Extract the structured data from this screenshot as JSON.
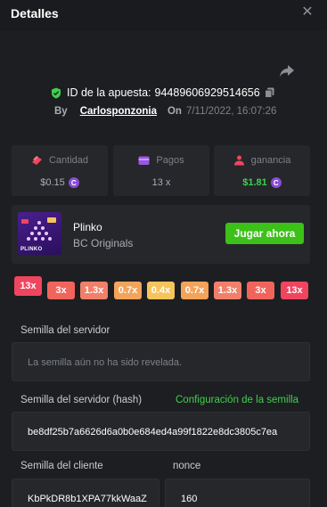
{
  "header": {
    "title": "Detalles",
    "close_icon": "close-icon"
  },
  "bet": {
    "id_label": "ID de la apuesta:",
    "id_value": "94489606929514656",
    "by_label": "By",
    "username": "Carlosponzonia",
    "on_label": "On",
    "date": "7/11/2022, 16:07:26"
  },
  "stats": {
    "amount": {
      "label": "Cantidad",
      "value": "$0.15",
      "icon": "coins-icon"
    },
    "payout": {
      "label": "Pagos",
      "value": "13 x",
      "icon": "wallet-icon"
    },
    "profit": {
      "label": "ganancia",
      "value": "$1.81",
      "icon": "profit-icon"
    },
    "coin_symbol": "C"
  },
  "game": {
    "name": "Plinko",
    "provider": "BC Originals",
    "thumbnail_label": "PLINKO",
    "play_label": "Jugar ahora"
  },
  "multipliers": [
    {
      "label": "13x",
      "color": "#f0455f",
      "selected": true
    },
    {
      "label": "3x",
      "color": "#f0645c"
    },
    {
      "label": "1.3x",
      "color": "#f0806a"
    },
    {
      "label": "0.7x",
      "color": "#f3a35a"
    },
    {
      "label": "0.4x",
      "color": "#f5c45a"
    },
    {
      "label": "0.7x",
      "color": "#f3a35a"
    },
    {
      "label": "1.3x",
      "color": "#f0806a"
    },
    {
      "label": "3x",
      "color": "#f0645c"
    },
    {
      "label": "13x",
      "color": "#f0455f"
    }
  ],
  "seeds": {
    "server_seed_label": "Semilla del servidor",
    "server_seed_value": "La semilla aún no ha sido revelada.",
    "server_hash_label": "Semilla del servidor (hash)",
    "seed_config_link": "Configuración de la semilla",
    "server_hash_value": "be8df25b7a6626d6a0b0e684ed4a99f1822e8dc3805c7ea",
    "client_seed_label": "Semilla del cliente",
    "client_seed_value": "KbPkDR8b1XPA77kkWaaZ",
    "nonce_label": "nonce",
    "nonce_value": "160"
  },
  "colors": {
    "accent_green": "#3bc117",
    "coin_purple": "#8a4bd8"
  }
}
